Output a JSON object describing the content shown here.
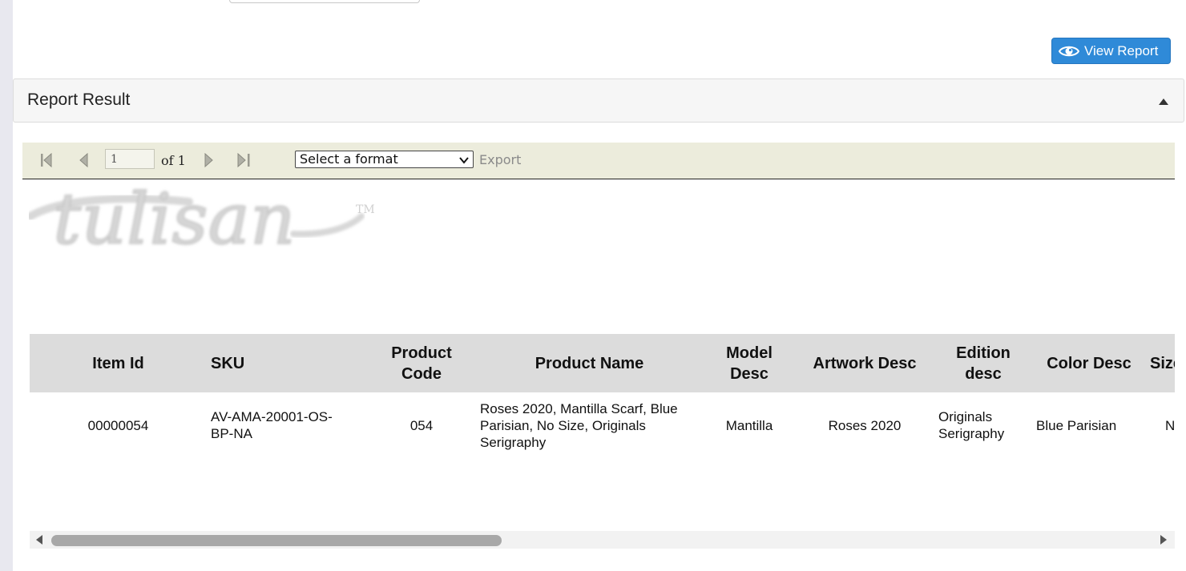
{
  "actions": {
    "view_report_label": "View Report",
    "view_report_icon": "eye-icon"
  },
  "report_result": {
    "title": "Report Result"
  },
  "toolbar": {
    "page_value": "1",
    "page_of": "of 1",
    "format_selected": "Select a format",
    "export_label": "Export"
  },
  "logo": {
    "text": "tulisan",
    "mark": "TM"
  },
  "table": {
    "headers": [
      "Item Id",
      "SKU",
      "Product Code",
      "Product Name",
      "Model Desc",
      "Artwork Desc",
      "Edition desc",
      "Color Desc",
      "Size Desc"
    ],
    "rows": [
      {
        "item_id": "00000054",
        "sku": "AV-AMA-20001-OS-BP-NA",
        "product_code": "054",
        "product_name": "Roses 2020, Mantilla Scarf, Blue Parisian, No Size, Originals Serigraphy",
        "model_desc": "Mantilla",
        "artwork_desc": "Roses 2020",
        "edition_desc": "Originals Serigraphy",
        "color_desc": "Blue Parisian",
        "size_desc": "No Size"
      }
    ]
  },
  "scrollbar": {
    "thumb_fraction": 0.39
  },
  "colors": {
    "accent": "#2f8ad8",
    "toolbar_bg": "#ececdc",
    "header_bg": "#dcdcdc"
  }
}
